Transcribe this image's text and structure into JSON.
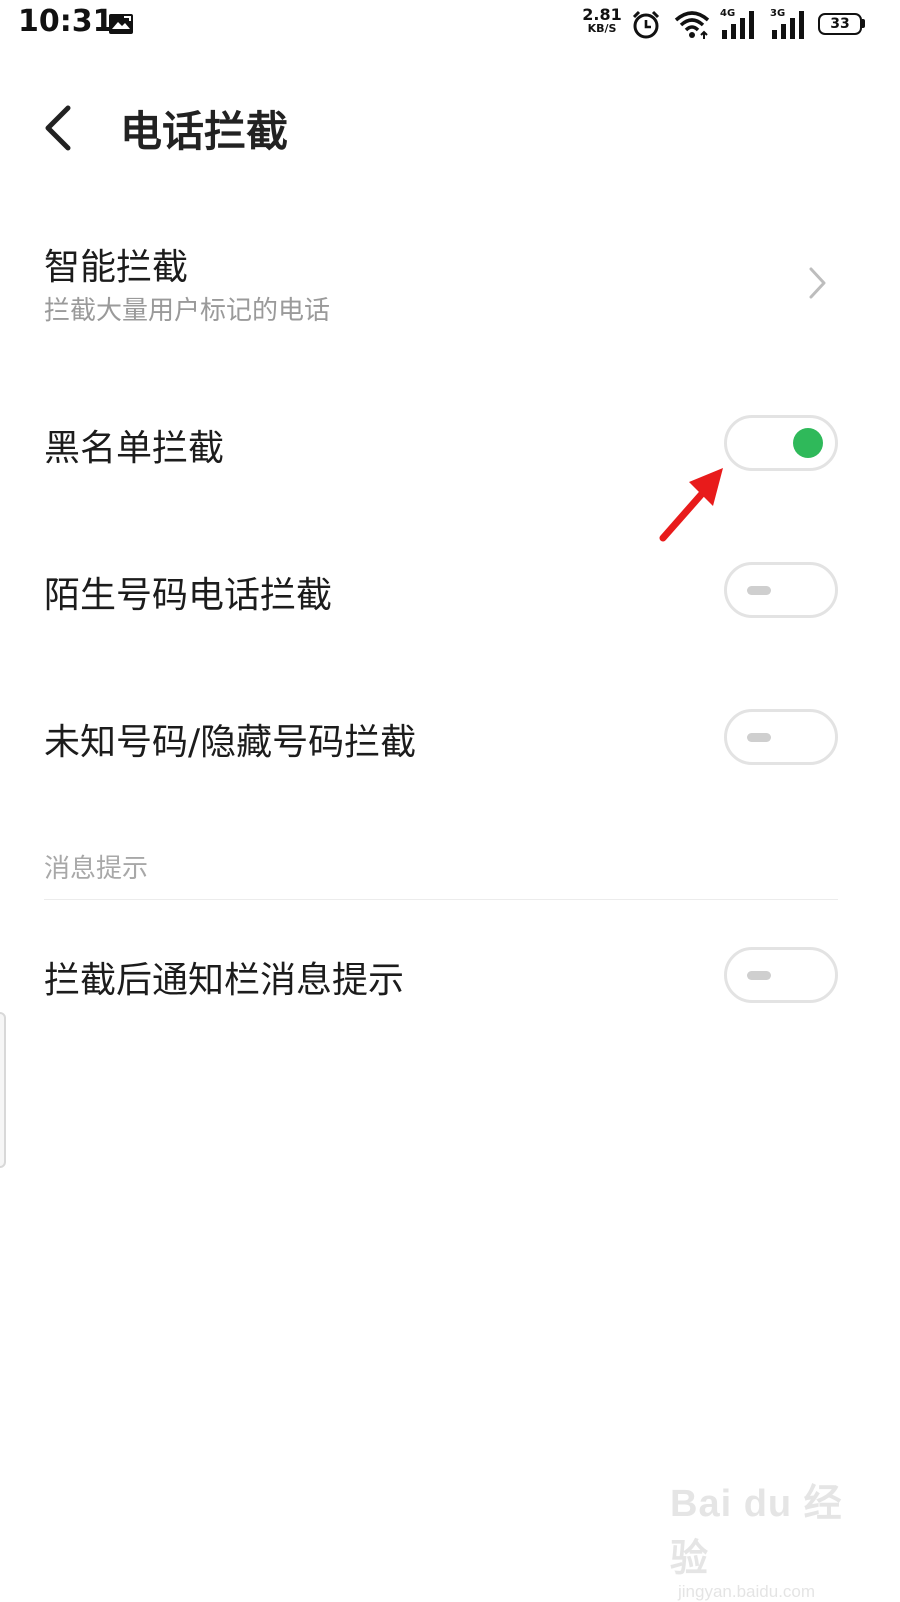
{
  "status_bar": {
    "time": "10:31",
    "net_speed_value": "2.81",
    "net_speed_unit": "KB/S",
    "sim1_network": "4G",
    "sim2_network": "3G",
    "battery_level": "33"
  },
  "header": {
    "title": "电话拦截"
  },
  "settings": {
    "smart_block": {
      "title": "智能拦截",
      "subtitle": "拦截大量用户标记的电话"
    },
    "blacklist_block": {
      "title": "黑名单拦截",
      "enabled": true
    },
    "stranger_block": {
      "title": "陌生号码电话拦截",
      "enabled": false
    },
    "unknown_hidden_block": {
      "title": "未知号码/隐藏号码拦截",
      "enabled": false
    }
  },
  "notification_section": {
    "label": "消息提示",
    "notify_after_block": {
      "title": "拦截后通知栏消息提示",
      "enabled": false
    }
  },
  "colors": {
    "toggle_on": "#2fb95a",
    "annotation_arrow": "#e81b1b"
  },
  "watermark": {
    "logo": "Bai du 经验",
    "url": "jingyan.baidu.com"
  }
}
